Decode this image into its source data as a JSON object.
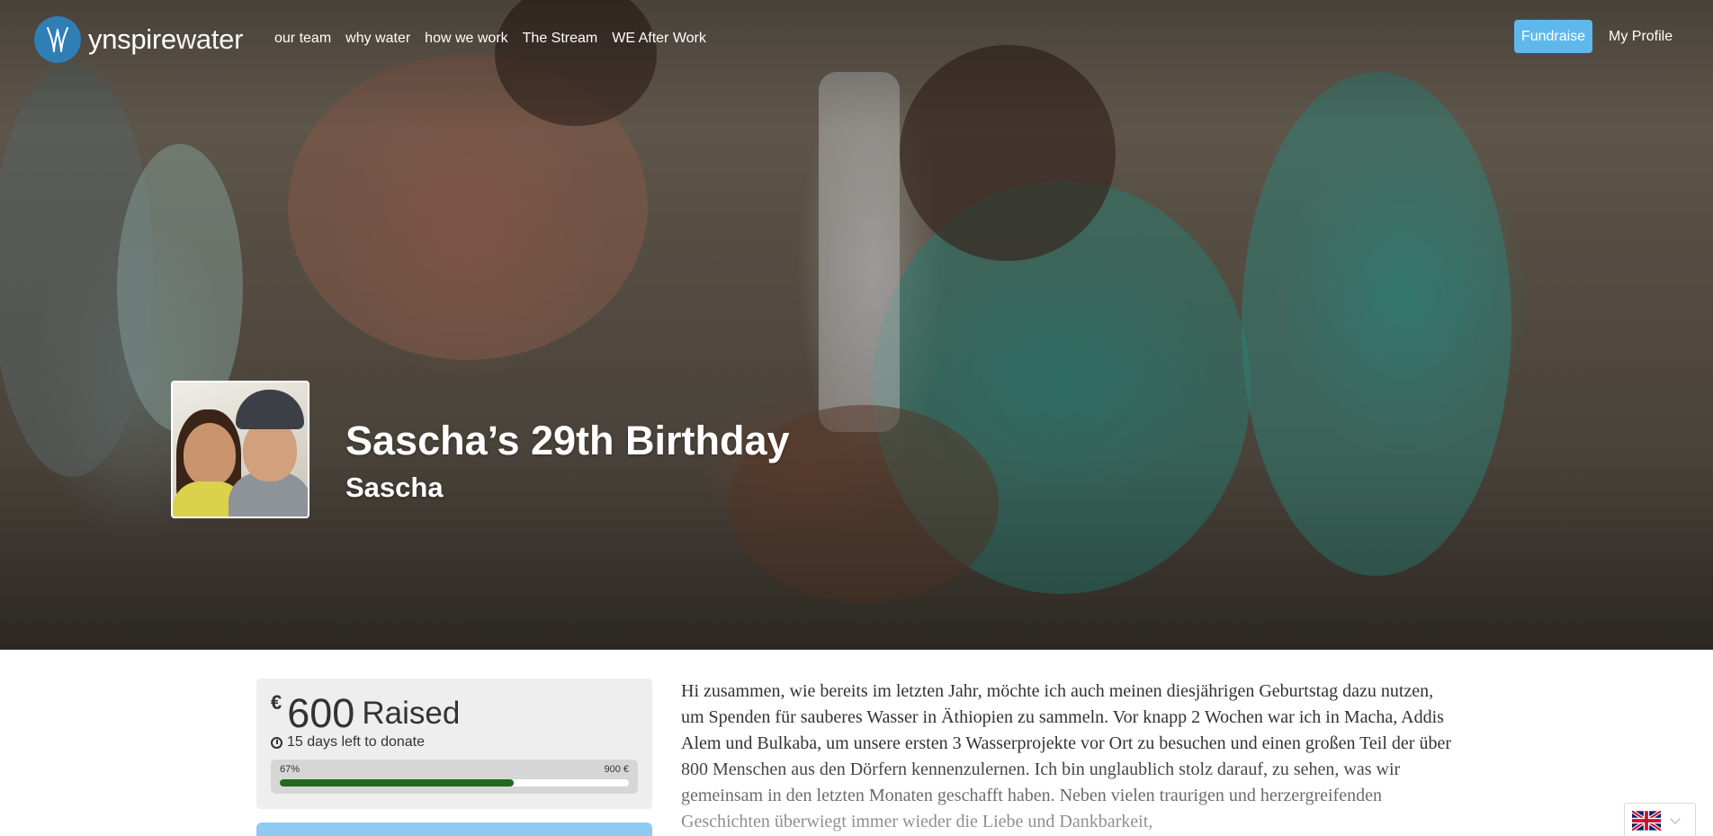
{
  "brand": {
    "logo_text_bold": "ynspire",
    "logo_text_light": "water"
  },
  "nav": {
    "items": [
      {
        "label": "our team"
      },
      {
        "label": "why water"
      },
      {
        "label": "how we work"
      },
      {
        "label": "The Stream"
      },
      {
        "label": "WE After Work"
      }
    ],
    "fundraise_label": "Fundraise",
    "profile_label": "My Profile"
  },
  "campaign": {
    "title": "Sascha’s 29th Birthday",
    "owner": "Sascha"
  },
  "stats": {
    "currency": "€",
    "raised_amount": "600",
    "raised_label": "Raised",
    "days_left": "15 days left to donate",
    "progress_percent_label": "67%",
    "progress_fraction": 0.67,
    "goal_label": "900 €"
  },
  "story": {
    "text": "Hi zusammen, wie bereits im letzten Jahr, möchte ich auch meinen diesjährigen Geburtstag dazu nutzen, um Spenden für sauberes Wasser in Äthiopien zu sammeln. Vor knapp 2 Wochen war ich in Macha, Addis Alem und Bulkaba, um unsere ersten 3 Wasserprojekte vor Ort zu besuchen und einen großen Teil der über 800 Menschen aus den Dörfern kennenzulernen. Ich bin unglaublich stolz darauf, zu sehen, was wir gemeinsam in den letzten Monaten geschafft haben. Neben vielen traurigen und herzergreifenden Geschichten überwiegt immer wieder die Liebe und Dankbarkeit,"
  },
  "colors": {
    "accent": "#5fb8ec",
    "progress": "#1e6b1e",
    "logo_circle": "#2f7fb5"
  },
  "icons": {
    "clock": "clock-icon",
    "flag": "uk-flag-icon",
    "logo": "ynspire-logo-icon"
  }
}
